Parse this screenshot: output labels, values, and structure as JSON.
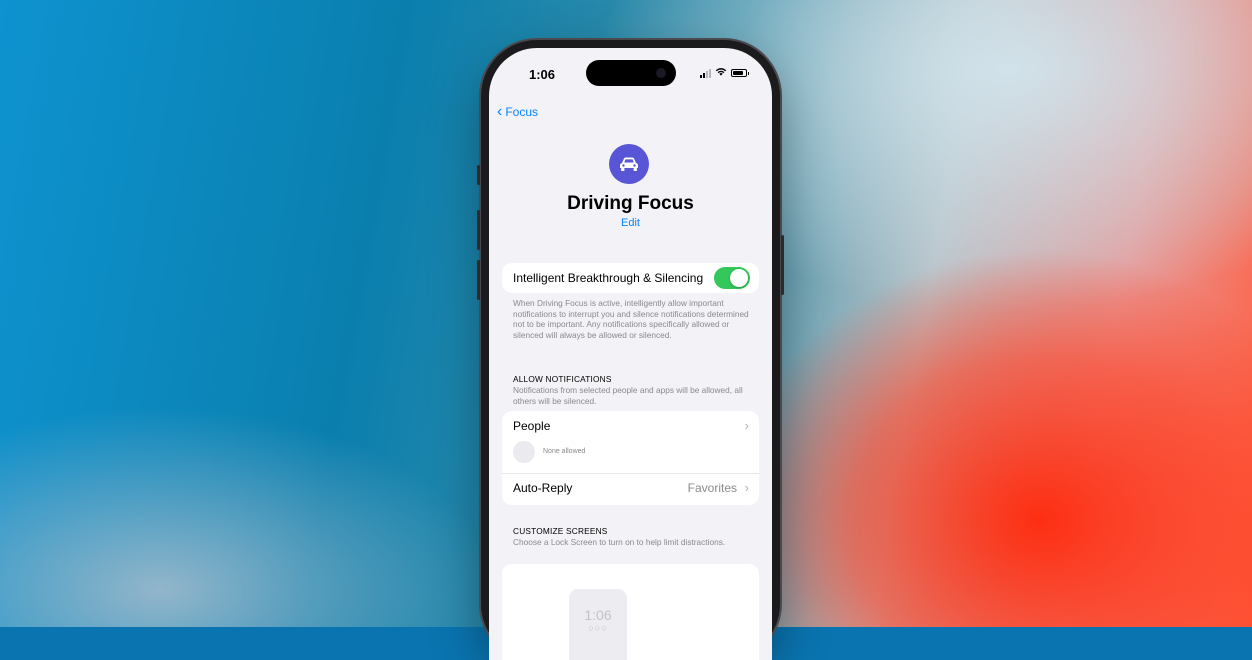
{
  "status_bar": {
    "time": "1:06"
  },
  "nav": {
    "back_label": "Focus"
  },
  "header": {
    "title": "Driving Focus",
    "edit_label": "Edit",
    "icon": "car-icon",
    "icon_color": "#5856d6"
  },
  "breakthrough": {
    "label": "Intelligent Breakthrough & Silencing",
    "enabled": true,
    "toggle_color": "#34c759",
    "description": "When Driving Focus is active, intelligently allow important notifications to interrupt you and silence notifications determined not to be important. Any notifications specifically allowed or silenced will always be allowed or silenced."
  },
  "allow_notifications": {
    "heading": "ALLOW NOTIFICATIONS",
    "description": "Notifications from selected people and apps will be allowed, all others will be silenced.",
    "people_label": "People",
    "people_status": "None allowed",
    "auto_reply_label": "Auto-Reply",
    "auto_reply_value": "Favorites"
  },
  "customize_screens": {
    "heading": "CUSTOMIZE SCREENS",
    "description": "Choose a Lock Screen to turn on to help limit distractions.",
    "lock_time": "1:06",
    "lock_dots": "○○○"
  }
}
